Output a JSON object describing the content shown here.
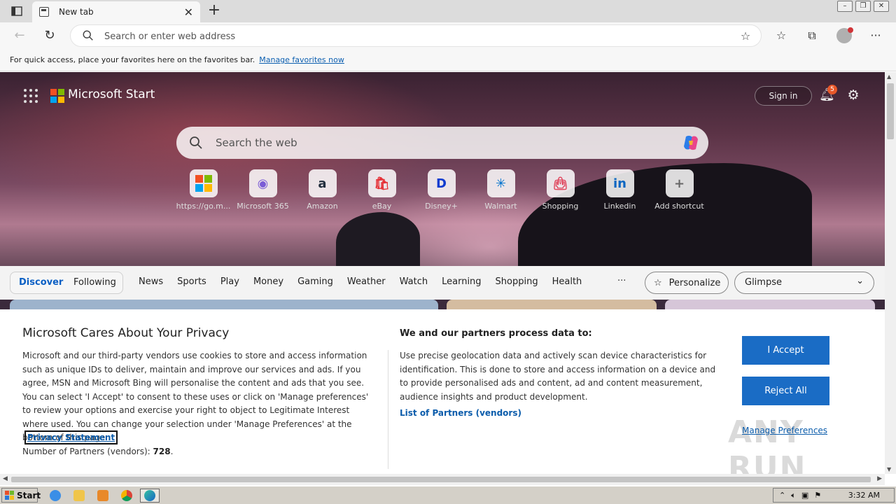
{
  "browser": {
    "tab_title": "New tab",
    "address_placeholder": "Search or enter web address",
    "favorites_hint": "For quick access, place your favorites here on the favorites bar.",
    "favorites_link": "Manage favorites now"
  },
  "start": {
    "brand": "Microsoft Start",
    "sign_in": "Sign in",
    "notification_count": "5",
    "search_placeholder": "Search the web",
    "shortcuts": [
      {
        "label": "https://go.m...",
        "icon": "microsoft-logo-icon",
        "color": "#ffffff"
      },
      {
        "label": "Microsoft 365",
        "icon": "m365-icon",
        "color": "#7b5cd6"
      },
      {
        "label": "Amazon",
        "icon": "amazon-icon",
        "color": "#232f3e"
      },
      {
        "label": "eBay",
        "icon": "ebay-icon",
        "color": "#e53238"
      },
      {
        "label": "Disney+",
        "icon": "disney-icon",
        "color": "#113ccf"
      },
      {
        "label": "Walmart",
        "icon": "walmart-icon",
        "color": "#0071ce"
      },
      {
        "label": "Shopping",
        "icon": "shopping-bag-icon",
        "color": "#e0445c"
      },
      {
        "label": "Linkedin",
        "icon": "linkedin-icon",
        "color": "#0a66c2"
      },
      {
        "label": "Add shortcut",
        "icon": "plus-icon",
        "color": "#666666"
      }
    ]
  },
  "feed": {
    "discover": "Discover",
    "following": "Following",
    "categories": [
      "News",
      "Sports",
      "Play",
      "Money",
      "Gaming",
      "Weather",
      "Watch",
      "Learning",
      "Shopping",
      "Health"
    ],
    "more": "···",
    "personalize": "Personalize",
    "layout_select": "Glimpse"
  },
  "privacy": {
    "title": "Microsoft Cares About Your Privacy",
    "body": "Microsoft and our third-party vendors use cookies to store and access information such as unique IDs to deliver, maintain and improve our services and ads. If you agree, MSN and Microsoft Bing will personalise the content and ads that you see. You can select 'I Accept' to consent to these uses or click on 'Manage preferences' to review your options and exercise your right to object to Legitimate Interest where used.  You can change your selection under 'Manage Preferences' at the bottom of this page.",
    "statement_link": "Privacy Statement",
    "partners_label": "Number of Partners (vendors):",
    "partners_count": "728",
    "partners_suffix": ".",
    "purposes_title": "We and our partners process data to:",
    "purposes_body": "Use precise geolocation data and actively scan device characteristics for identification. This is done to store and access information on a device and to provide personalised ads and content, ad and content measurement, audience insights and product development.",
    "partners_link": "List of Partners (vendors)",
    "accept": "I Accept",
    "reject": "Reject All",
    "manage": "Manage Preferences"
  },
  "watermark": "ANY RUN",
  "taskbar": {
    "start": "Start",
    "clock": "3:32 AM"
  },
  "colors": {
    "accent": "#1a6cc5",
    "link": "#0b5cab"
  }
}
